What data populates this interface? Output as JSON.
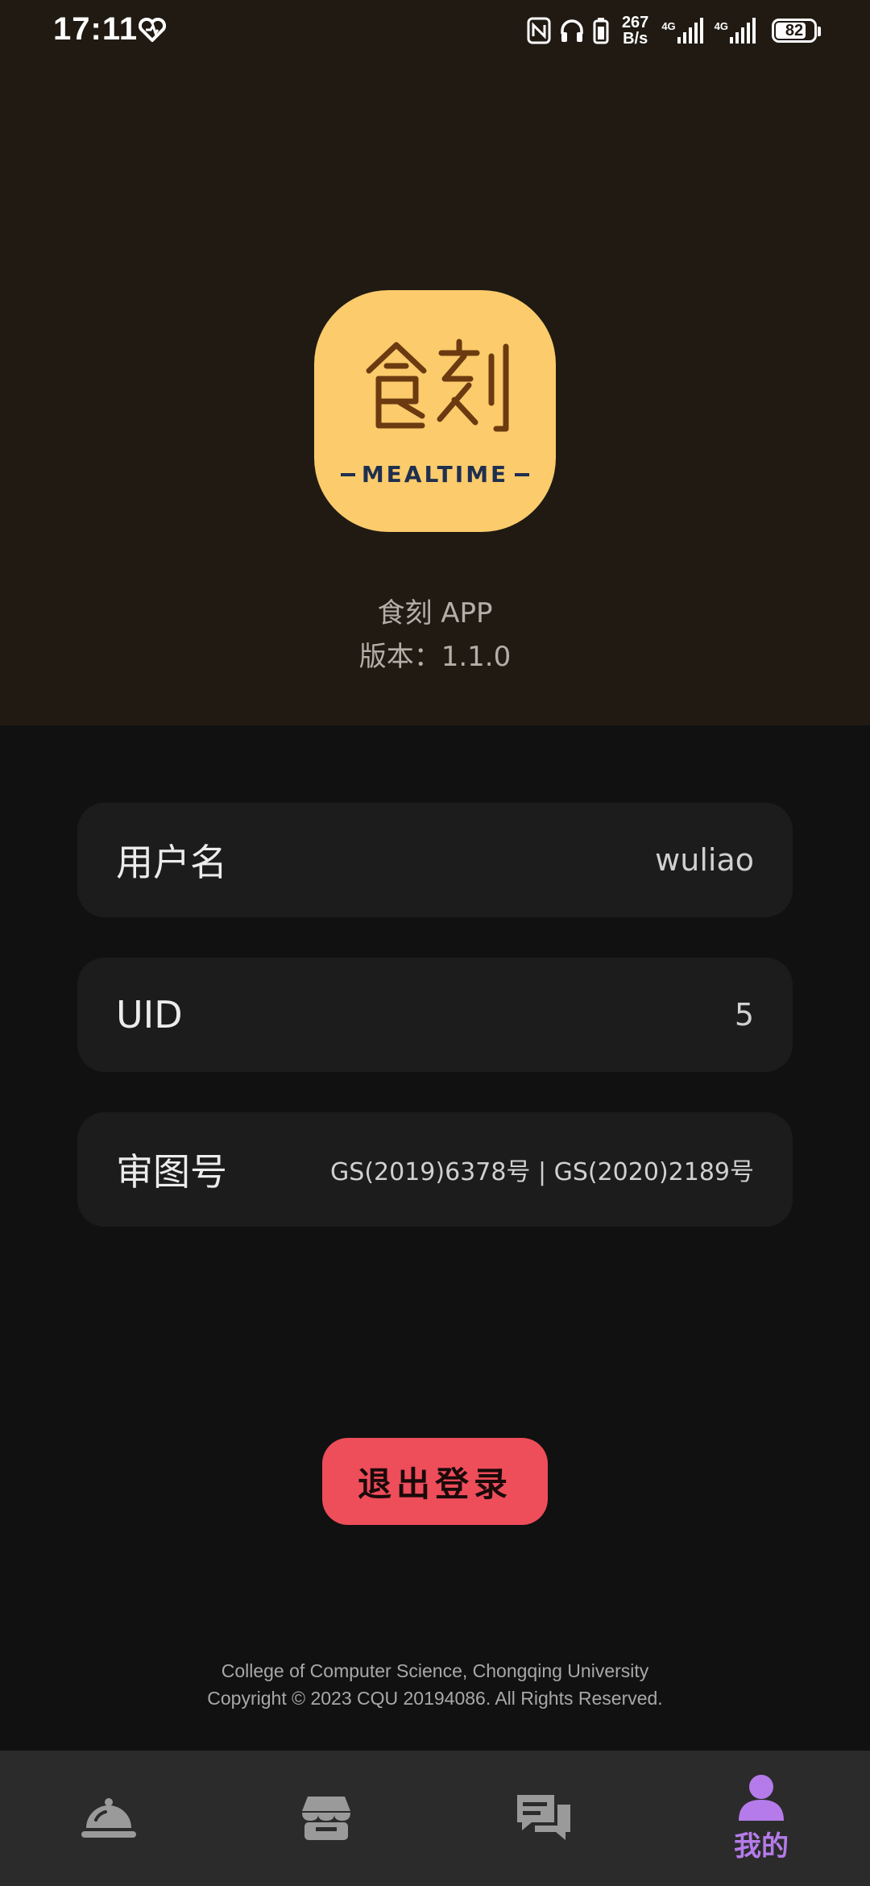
{
  "status_bar": {
    "time": "17:11",
    "net_speed_value": "267",
    "net_speed_unit": "B/s",
    "net1_label": "4G",
    "net2_label": "4G",
    "battery_level": "82"
  },
  "app": {
    "logo_cn": "食刻",
    "logo_en": "MEALTIME",
    "name": "食刻 APP",
    "version": "版本：1.1.0"
  },
  "info": {
    "username_label": "用户名",
    "username_value": "wuliao",
    "uid_label": "UID",
    "uid_value": "5",
    "map_label": "审图号",
    "map_value": "GS(2019)6378号 | GS(2020)2189号"
  },
  "logout_label": "退出登录",
  "footer": {
    "line1": "College of Computer Science, Chongqing University",
    "line2": "Copyright © 2023 CQU 20194086. All Rights Reserved."
  },
  "nav": {
    "items": [
      {
        "icon": "food-cloche-icon",
        "label": ""
      },
      {
        "icon": "store-icon",
        "label": ""
      },
      {
        "icon": "chat-icon",
        "label": ""
      },
      {
        "icon": "user-icon",
        "label": "我的"
      }
    ],
    "active_color": "#b57bea",
    "inactive_color": "#9a9a9a"
  }
}
